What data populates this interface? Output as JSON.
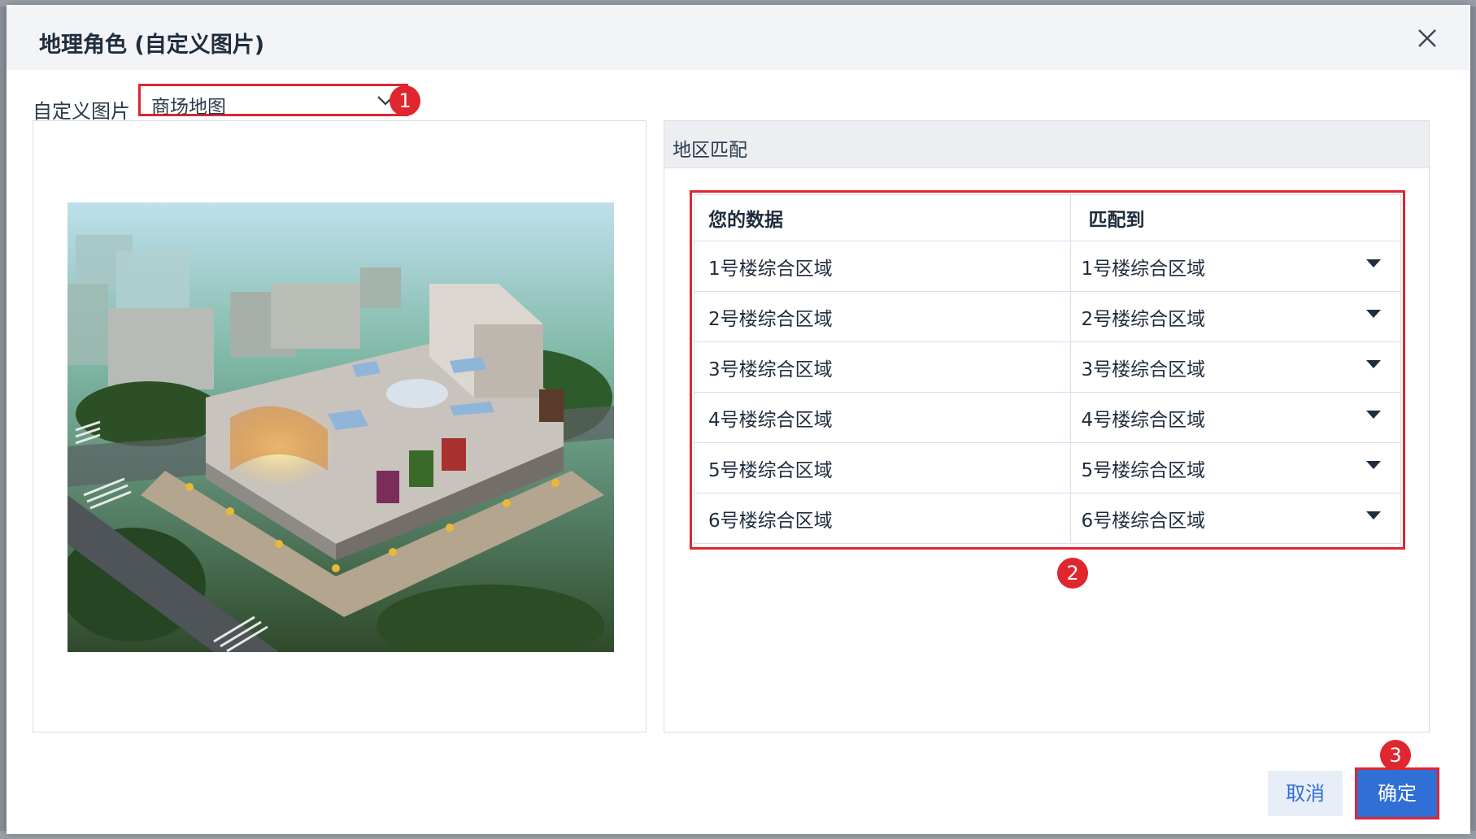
{
  "dialog": {
    "title": "地理角色 (自定义图片)"
  },
  "picker": {
    "label": "自定义图片",
    "value": "商场地图"
  },
  "match_panel": {
    "title": "地区匹配",
    "columns": [
      "您的数据",
      "匹配到"
    ],
    "rows": [
      {
        "data": "1号楼综合区域",
        "match": "1号楼综合区域"
      },
      {
        "data": "2号楼综合区域",
        "match": "2号楼综合区域"
      },
      {
        "data": "3号楼综合区域",
        "match": "3号楼综合区域"
      },
      {
        "data": "4号楼综合区域",
        "match": "4号楼综合区域"
      },
      {
        "data": "5号楼综合区域",
        "match": "5号楼综合区域"
      },
      {
        "data": "6号楼综合区域",
        "match": "6号楼综合区域"
      }
    ]
  },
  "markers": [
    "1",
    "2",
    "3"
  ],
  "footer": {
    "cancel_label": "取消",
    "ok_label": "确定"
  },
  "icons": {
    "close": "close-icon",
    "chevron": "chevron-down-icon",
    "dropdown_arrow": "triangle-down-icon"
  },
  "colors": {
    "accent": "#2f6fd6",
    "highlight": "#e0262e",
    "header_bg": "#f3f4f7"
  }
}
